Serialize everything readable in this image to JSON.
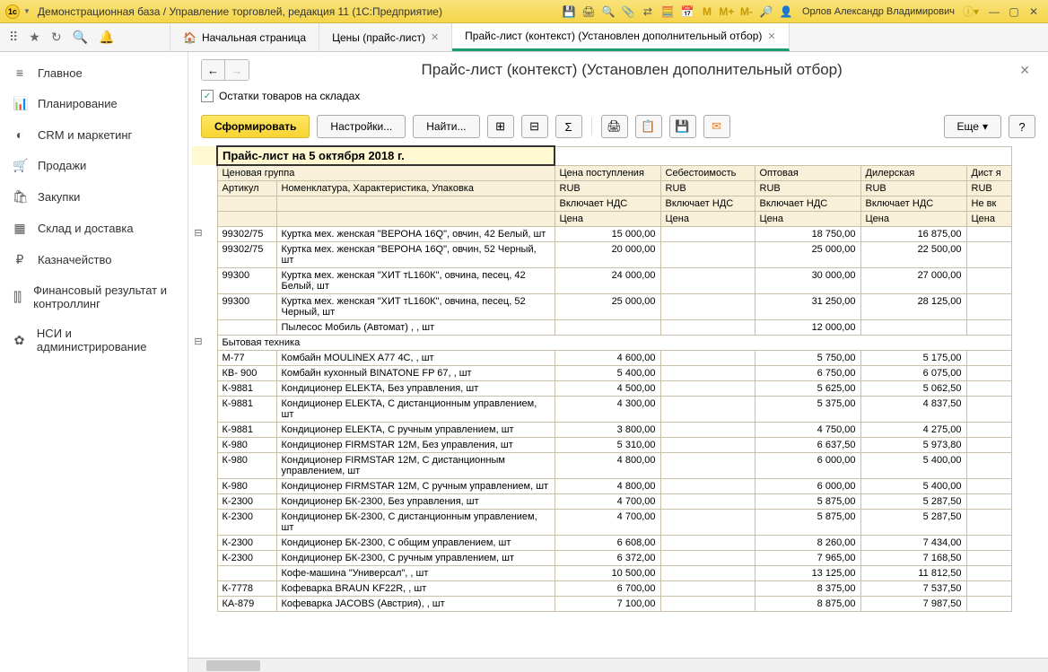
{
  "titlebar": {
    "title": "Демонстрационная база / Управление торговлей, редакция 11  (1С:Предприятие)",
    "user": "Орлов Александр Владимирович",
    "memory": {
      "m": "M",
      "mplus": "M+",
      "mminus": "M-"
    }
  },
  "tabs": {
    "home": "Начальная страница",
    "prices": "Цены (прайс-лист)",
    "pricelist": "Прайс-лист (контекст) (Установлен дополнительный отбор)"
  },
  "sidebar": {
    "items": [
      {
        "icon": "≡",
        "label": "Главное"
      },
      {
        "icon": "📊",
        "label": "Планирование"
      },
      {
        "icon": "◐",
        "label": "CRM и маркетинг"
      },
      {
        "icon": "🛒",
        "label": "Продажи"
      },
      {
        "icon": "🛍",
        "label": "Закупки"
      },
      {
        "icon": "▦",
        "label": "Склад и доставка"
      },
      {
        "icon": "₽",
        "label": "Казначейство"
      },
      {
        "icon": "⫿⫿",
        "label": "Финансовый результат и контроллинг"
      },
      {
        "icon": "✿",
        "label": "НСИ и администрирование"
      }
    ]
  },
  "page": {
    "title": "Прайс-лист (контекст) (Установлен дополнительный отбор)",
    "filter_checkbox_label": "Остатки товаров на складах",
    "toolbar": {
      "generate": "Сформировать",
      "settings": "Настройки...",
      "find": "Найти...",
      "more": "Еще"
    }
  },
  "report": {
    "title": "Прайс-лист на 5 октября 2018 г.",
    "headers": {
      "group": "Ценовая группа",
      "article": "Артикул",
      "nomenclature": "Номенклатура, Характеристика, Упаковка",
      "price_in": "Цена поступления",
      "cost": "Себестоимость",
      "wholesale": "Оптовая",
      "dealer": "Дилерская",
      "dist": "Дист я",
      "currency": "RUB",
      "vat": "Включает НДС",
      "novat": "Не вк",
      "price": "Цена"
    },
    "rows": [
      {
        "tree": "⊟",
        "art": "99302/75",
        "name": "Куртка мех. женская \"ВЕРОНА 16Q\", овчин, 42 Белый, шт",
        "c1": "15 000,00",
        "c2": "",
        "c3": "18 750,00",
        "c4": "16 875,00"
      },
      {
        "art": "99302/75",
        "name": "Куртка мех. женская \"ВЕРОНА 16Q\", овчин, 52 Черный, шт",
        "c1": "20 000,00",
        "c2": "",
        "c3": "25 000,00",
        "c4": "22 500,00"
      },
      {
        "art": "99300",
        "name": "Куртка мех. женская \"ХИТ тL160К\", овчина, песец, 42 Белый, шт",
        "c1": "24 000,00",
        "c2": "",
        "c3": "30 000,00",
        "c4": "27 000,00"
      },
      {
        "art": "99300",
        "name": "Куртка мех. женская \"ХИТ тL160К\", овчина, песец, 52 Черный, шт",
        "c1": "25 000,00",
        "c2": "",
        "c3": "31 250,00",
        "c4": "28 125,00"
      },
      {
        "art": "",
        "name": "Пылесос Мобиль (Автомат) , , шт",
        "c1": "",
        "c2": "",
        "c3": "12 000,00",
        "c4": ""
      },
      {
        "tree": "⊟",
        "cat": true,
        "name": "Бытовая техника"
      },
      {
        "art": "М-77",
        "name": "Комбайн MOULINEX  A77 4C, , шт",
        "c1": "4 600,00",
        "c2": "",
        "c3": "5 750,00",
        "c4": "5 175,00"
      },
      {
        "art": "КВ- 900",
        "name": "Комбайн кухонный BINATONE FP 67, , шт",
        "c1": "5 400,00",
        "c2": "",
        "c3": "6 750,00",
        "c4": "6 075,00"
      },
      {
        "art": "К-9881",
        "name": "Кондиционер ELEKTA, Без управления, шт",
        "c1": "4 500,00",
        "c2": "",
        "c3": "5 625,00",
        "c4": "5 062,50"
      },
      {
        "art": "К-9881",
        "name": "Кондиционер ELEKTA, С дистанционным управлением, шт",
        "c1": "4 300,00",
        "c2": "",
        "c3": "5 375,00",
        "c4": "4 837,50"
      },
      {
        "art": "К-9881",
        "name": "Кондиционер ELEKTA, С ручным управлением, шт",
        "c1": "3 800,00",
        "c2": "",
        "c3": "4 750,00",
        "c4": "4 275,00"
      },
      {
        "art": "К-980",
        "name": "Кондиционер FIRMSTAR 12M, Без управления, шт",
        "c1": "5 310,00",
        "c2": "",
        "c3": "6 637,50",
        "c4": "5 973,80"
      },
      {
        "art": "К-980",
        "name": "Кондиционер FIRMSTAR 12M, С дистанционным управлением, шт",
        "c1": "4 800,00",
        "c2": "",
        "c3": "6 000,00",
        "c4": "5 400,00"
      },
      {
        "art": "К-980",
        "name": "Кондиционер FIRMSTAR 12M, С ручным управлением, шт",
        "c1": "4 800,00",
        "c2": "",
        "c3": "6 000,00",
        "c4": "5 400,00"
      },
      {
        "art": "К-2300",
        "name": "Кондиционер БК-2300, Без управления, шт",
        "c1": "4 700,00",
        "c2": "",
        "c3": "5 875,00",
        "c4": "5 287,50"
      },
      {
        "art": "К-2300",
        "name": "Кондиционер БК-2300, С дистанционным управлением, шт",
        "c1": "4 700,00",
        "c2": "",
        "c3": "5 875,00",
        "c4": "5 287,50"
      },
      {
        "art": "К-2300",
        "name": "Кондиционер БК-2300, С общим управлением, шт",
        "c1": "6 608,00",
        "c2": "",
        "c3": "8 260,00",
        "c4": "7 434,00"
      },
      {
        "art": "К-2300",
        "name": "Кондиционер БК-2300, С ручным управлением, шт",
        "c1": "6 372,00",
        "c2": "",
        "c3": "7 965,00",
        "c4": "7 168,50"
      },
      {
        "art": "",
        "name": "Кофе-машина \"Универсал\", , шт",
        "c1": "10 500,00",
        "c2": "",
        "c3": "13 125,00",
        "c4": "11 812,50"
      },
      {
        "art": "К-7778",
        "name": "Кофеварка BRAUN KF22R, , шт",
        "c1": "6 700,00",
        "c2": "",
        "c3": "8 375,00",
        "c4": "7 537,50"
      },
      {
        "art": "КА-879",
        "name": "Кофеварка JACOBS (Австрия), , шт",
        "c1": "7 100,00",
        "c2": "",
        "c3": "8 875,00",
        "c4": "7 987,50"
      }
    ]
  }
}
